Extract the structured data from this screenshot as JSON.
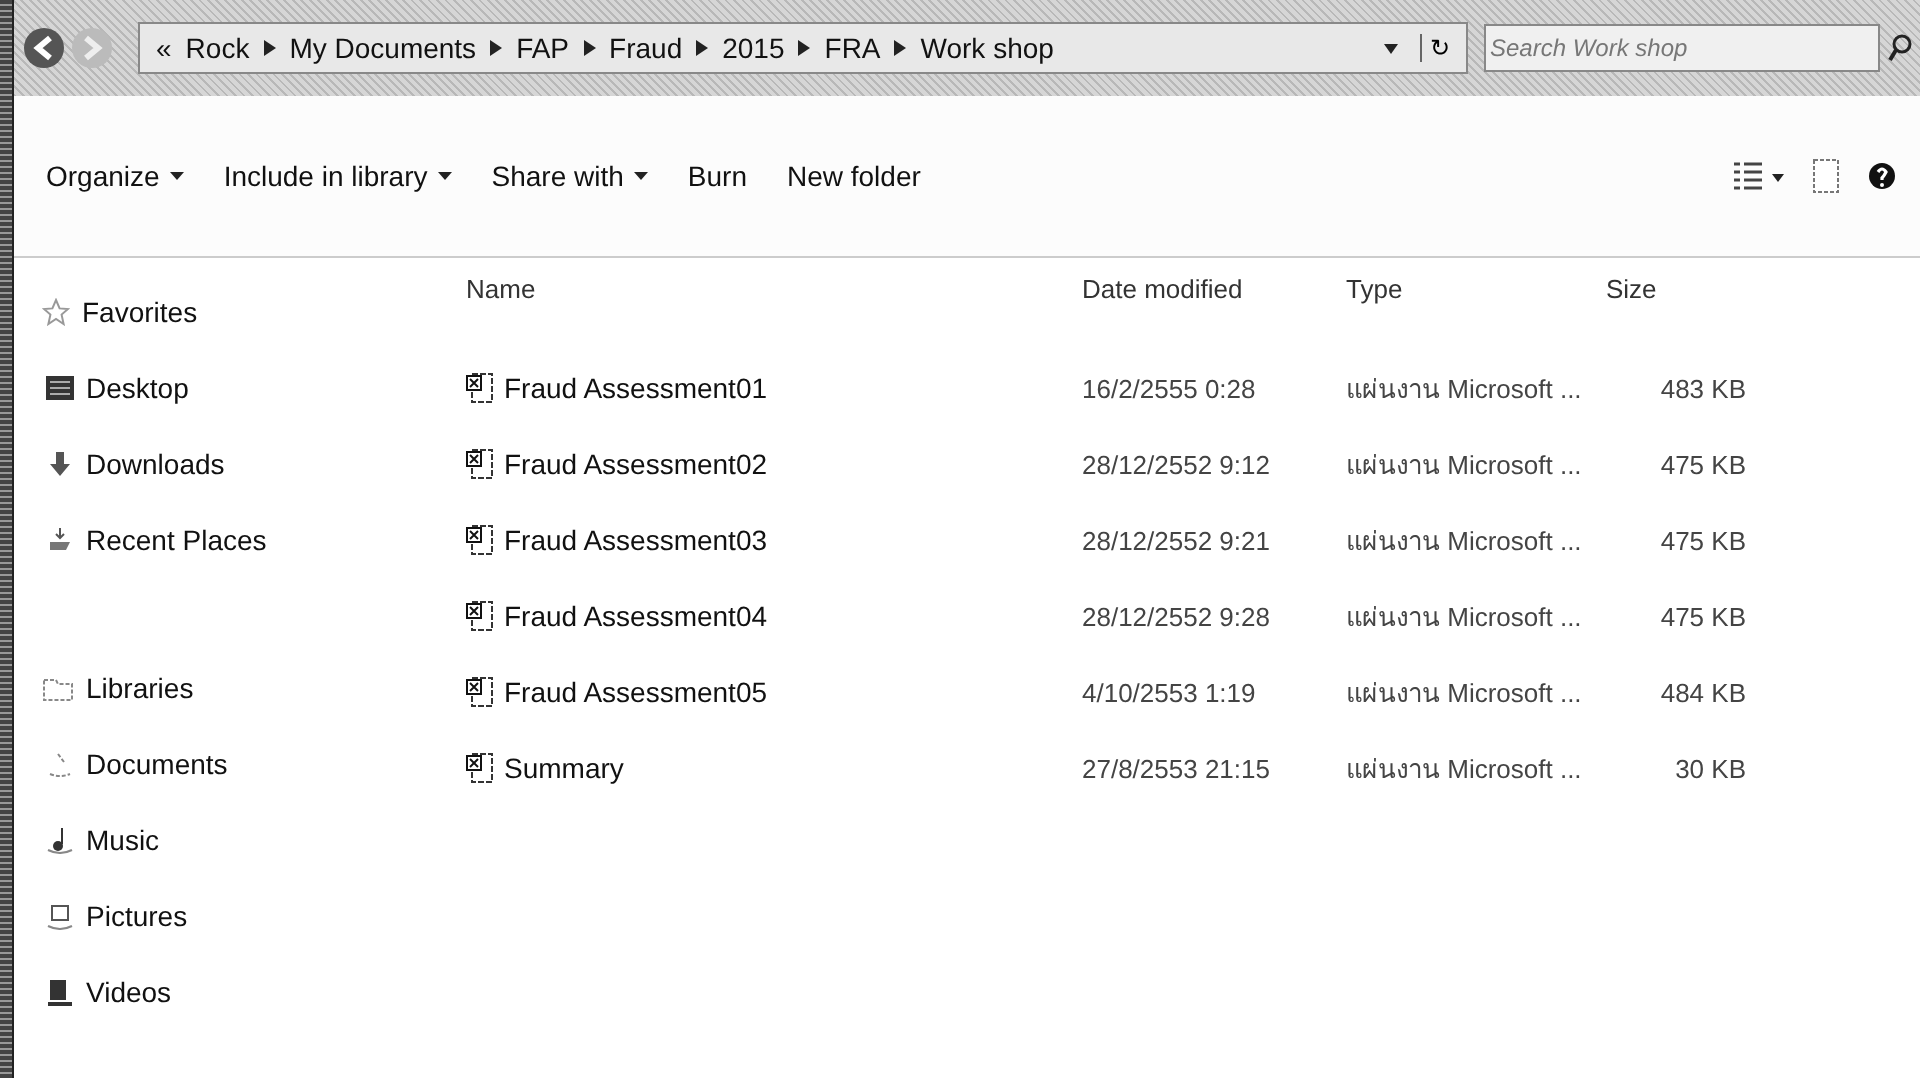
{
  "navigation": {
    "breadcrumb": [
      "«",
      "Rock",
      "My Documents",
      "FAP",
      "Fraud",
      "2015",
      "FRA",
      "Work shop"
    ],
    "refresh": "↻",
    "search": {
      "placeholder": "Search Work shop"
    }
  },
  "toolbar": {
    "items": [
      {
        "label": "Organize",
        "dropdown": true
      },
      {
        "label": "Include in library",
        "dropdown": true
      },
      {
        "label": "Share with",
        "dropdown": true
      },
      {
        "label": "Burn",
        "dropdown": false
      },
      {
        "label": "New folder",
        "dropdown": false
      }
    ]
  },
  "sidebar": {
    "groups": [
      {
        "title": "Favorites",
        "kind": "star",
        "items": [
          {
            "label": "Desktop",
            "kind": "desktop"
          },
          {
            "label": "Downloads",
            "kind": "download"
          },
          {
            "label": "Recent Places",
            "kind": "recent"
          }
        ]
      },
      {
        "title": "Libraries",
        "kind": "library",
        "items": [
          {
            "label": "Documents",
            "kind": "document"
          },
          {
            "label": "Music",
            "kind": "music"
          },
          {
            "label": "Pictures",
            "kind": "picture"
          },
          {
            "label": "Videos",
            "kind": "video"
          }
        ]
      }
    ]
  },
  "table": {
    "columns": [
      "Name",
      "Date modified",
      "Type",
      "Size"
    ],
    "rows": [
      {
        "name": "Fraud Assessment01",
        "date": "16/2/2555 0:28",
        "type": "แผ่นงาน Microsoft ...",
        "size": "483 KB"
      },
      {
        "name": "Fraud Assessment02",
        "date": "28/12/2552 9:12",
        "type": "แผ่นงาน Microsoft ...",
        "size": "475 KB"
      },
      {
        "name": "Fraud Assessment03",
        "date": "28/12/2552 9:21",
        "type": "แผ่นงาน Microsoft ...",
        "size": "475 KB"
      },
      {
        "name": "Fraud Assessment04",
        "date": "28/12/2552 9:28",
        "type": "แผ่นงาน Microsoft ...",
        "size": "475 KB"
      },
      {
        "name": "Fraud Assessment05",
        "date": "4/10/2553 1:19",
        "type": "แผ่นงาน Microsoft ...",
        "size": "484 KB"
      },
      {
        "name": "Summary",
        "date": "27/8/2553 21:15",
        "type": "แผ่นงาน Microsoft ...",
        "size": "30 KB"
      }
    ]
  }
}
